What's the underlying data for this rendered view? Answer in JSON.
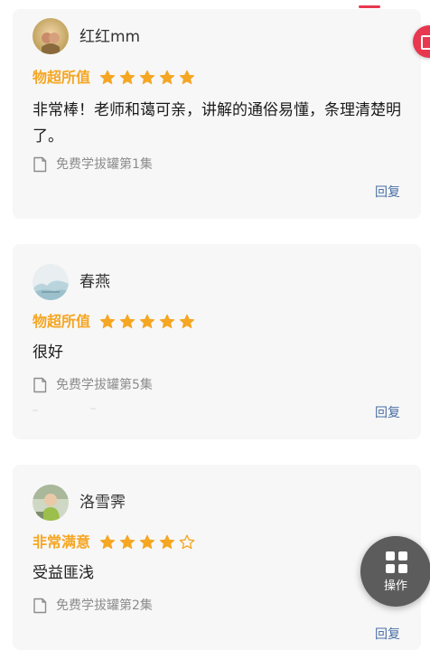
{
  "reviews": [
    {
      "username": "红红mm",
      "rating_text": "物超所值",
      "rating": 5,
      "comment": "非常棒！老师和蔼可亲，讲解的通俗易懂，条理清楚明了。",
      "episode": "免费学拔罐第1集",
      "reply_label": "回复"
    },
    {
      "username": "春燕",
      "rating_text": "物超所值",
      "rating": 5,
      "comment": "很好",
      "episode": "免费学拔罐第5集",
      "reply_label": "回复"
    },
    {
      "username": "洛雪霁",
      "rating_text": "非常满意",
      "rating": 4,
      "comment": "受益匪浅",
      "episode": "免费学拔罐第2集",
      "reply_label": "回复"
    }
  ],
  "fab": {
    "label": "操作",
    "icon": "grid-icon"
  },
  "colors": {
    "accent_orange": "#f5a623",
    "star_empty": "#f5a623",
    "reply_blue": "#4a6fa5",
    "brand_red": "#e8384f",
    "card_bg": "#f7f7f7"
  }
}
